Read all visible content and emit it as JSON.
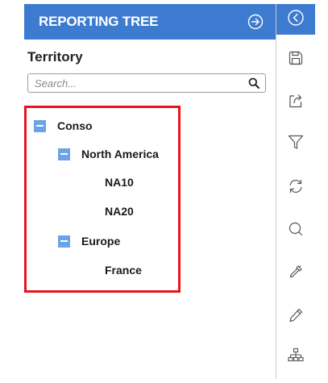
{
  "panel": {
    "title": "REPORTING TREE",
    "dimension_label": "Territory",
    "search": {
      "placeholder": "Search...",
      "value": ""
    }
  },
  "tree": {
    "nodes": [
      {
        "label": "Conso",
        "expanded": true,
        "level": 0
      },
      {
        "label": "North America",
        "expanded": true,
        "level": 1
      },
      {
        "label": "NA10",
        "level": 2
      },
      {
        "label": "NA20",
        "level": 2
      },
      {
        "label": "Europe",
        "expanded": true,
        "level": 1
      },
      {
        "label": "France",
        "level": 2
      }
    ]
  },
  "toolbar": {
    "icons": [
      "collapse-icon",
      "save-icon",
      "export-icon",
      "filter-icon",
      "refresh-icon",
      "search-icon",
      "eyedropper-icon",
      "edit-icon",
      "hierarchy-icon"
    ]
  },
  "colors": {
    "header_blue": "#3d7bd1",
    "toggle_blue": "#6aa3e6",
    "highlight_red": "#e8141c"
  }
}
